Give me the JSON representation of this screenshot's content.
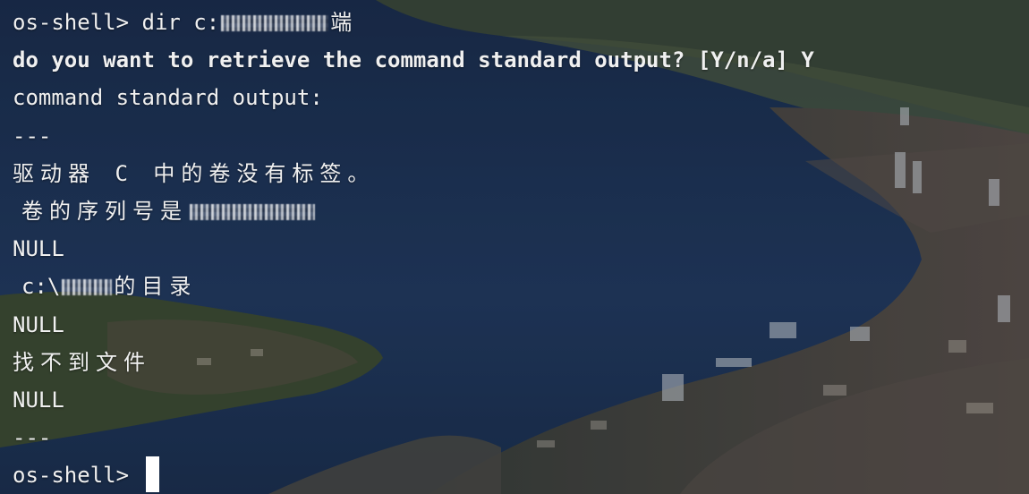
{
  "terminal": {
    "prompt_line": {
      "prompt": "os-shell>",
      "command_prefix": "dir c:",
      "command_suffix": "端"
    },
    "question": "do you want to retrieve the command standard output? [Y/n/a] Y",
    "output_header": "command standard output:",
    "separator_top": "---",
    "volume_no_label": "驱动器 C 中的卷没有标签。",
    "serial_label": "卷的序列号是",
    "null_1": "NULL",
    "directory_prefix": "c:\\",
    "directory_suffix": "的目录",
    "null_2": "NULL",
    "file_not_found": "找不到文件",
    "null_3": "NULL",
    "separator_bottom": "---",
    "final_prompt": "os-shell>"
  },
  "colors": {
    "text": "#f0f0f0",
    "cursor": "#ffffff",
    "water": "#1f3456",
    "land": "#4a5a3c"
  }
}
